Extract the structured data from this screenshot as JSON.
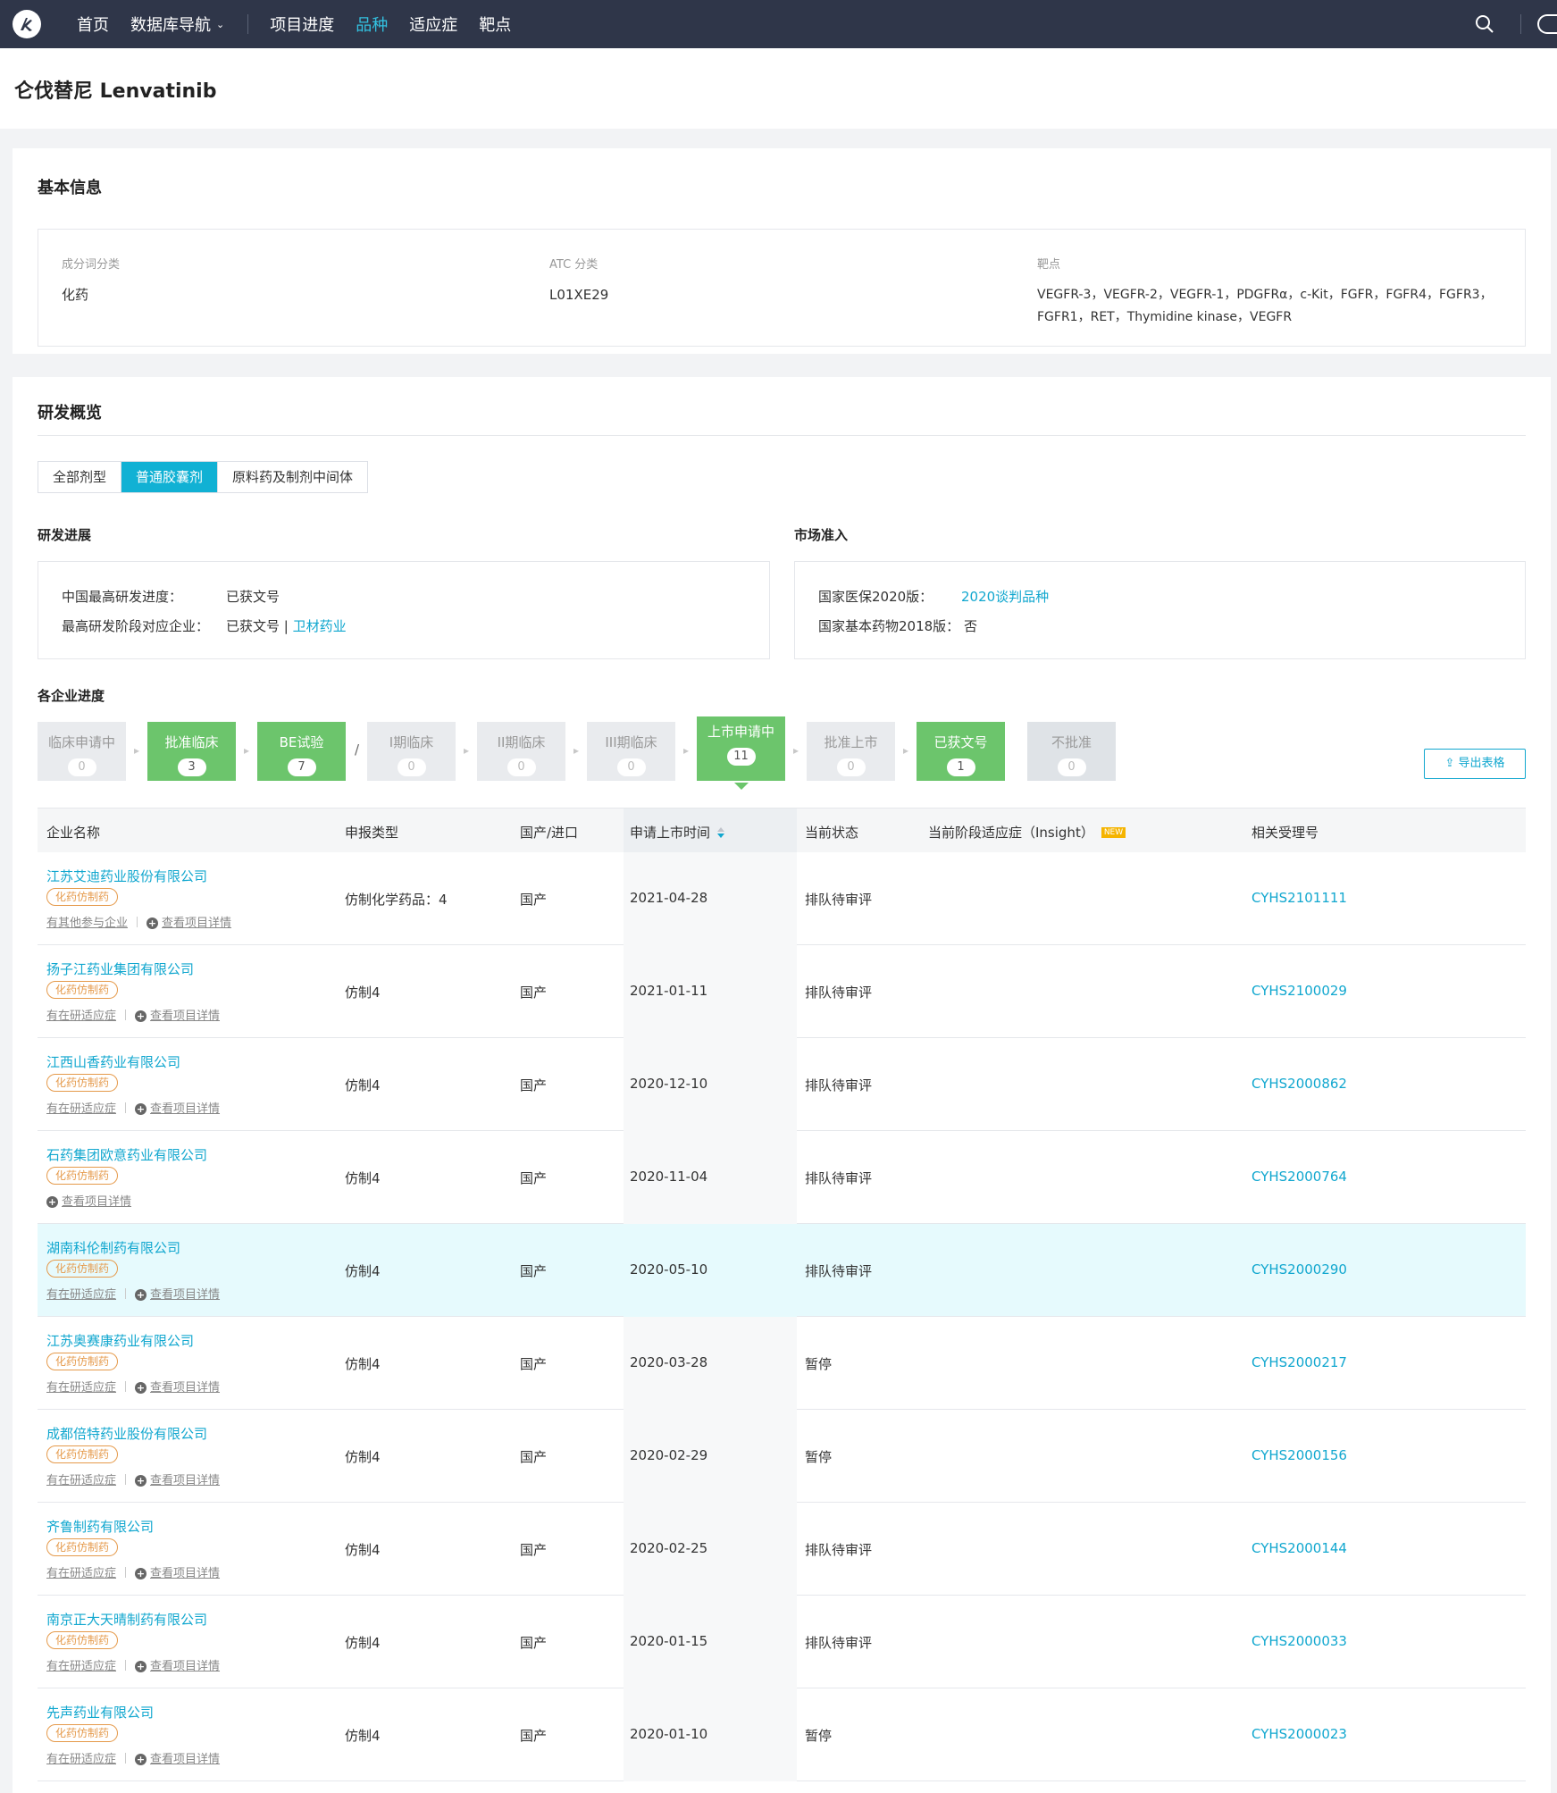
{
  "nav": {
    "items": [
      "首页",
      "数据库导航",
      "项目进度",
      "品种",
      "适应症",
      "靶点"
    ]
  },
  "page": {
    "title": "仑伐替尼 Lenvatinib"
  },
  "basic": {
    "title": "基本信息",
    "fields": [
      {
        "label": "成分词分类",
        "value": "化药"
      },
      {
        "label": "ATC 分类",
        "value": "L01XE29"
      },
      {
        "label": "靶点",
        "value": "VEGFR-3，VEGFR-2，VEGFR-1，PDGFRα，c-Kit，FGFR，FGFR4，FGFR3，FGFR1，RET，Thymidine kinase，VEGFR"
      }
    ]
  },
  "overview": {
    "title": "研发概览",
    "tabs": [
      "全部剂型",
      "普通胶囊剂",
      "原料药及制剂中间体"
    ],
    "active_tab": 1,
    "progress": {
      "title": "研发进展",
      "highest_label": "中国最高研发进度：",
      "highest_value": "已获文号",
      "company_label": "最高研发阶段对应企业：",
      "company_value": "已获文号 |",
      "company_link": "卫材药业"
    },
    "market": {
      "title": "市场准入",
      "insurance_label": "国家医保2020版：",
      "insurance_value": "2020谈判品种",
      "essential_label": "国家基本药物2018版：",
      "essential_value": "否"
    },
    "company_progress_title": "各企业进度",
    "stages": [
      {
        "name": "临床申请中",
        "count": "0",
        "state": "gray"
      },
      {
        "name": "批准临床",
        "count": "3",
        "state": "green"
      },
      {
        "name": "BE试验",
        "count": "7",
        "state": "green"
      },
      {
        "name": "I期临床",
        "count": "0",
        "state": "gray"
      },
      {
        "name": "II期临床",
        "count": "0",
        "state": "gray"
      },
      {
        "name": "III期临床",
        "count": "0",
        "state": "gray"
      },
      {
        "name": "上市申请中",
        "count": "11",
        "state": "selected"
      },
      {
        "name": "批准上市",
        "count": "0",
        "state": "gray"
      },
      {
        "name": "已获文号",
        "count": "1",
        "state": "green"
      },
      {
        "name": "不批准",
        "count": "0",
        "state": "gray2"
      }
    ],
    "export_label": "导出表格"
  },
  "table": {
    "headers": [
      "企业名称",
      "申报类型",
      "国产/进口",
      "申请上市时间",
      "当前状态",
      "当前阶段适应症（Insight）",
      "相关受理号"
    ],
    "new_badge": "NEW",
    "rows": [
      {
        "company": "江苏艾迪药业股份有限公司",
        "tag": "化药仿制药",
        "link1": "有其他参与企业",
        "link2": "查看项目详情",
        "type": "仿制化学药品：4",
        "origin": "国产",
        "date": "2021-04-28",
        "status": "排队待审评",
        "indication": "",
        "accept_no": "CYHS2101111"
      },
      {
        "company": "扬子江药业集团有限公司",
        "tag": "化药仿制药",
        "link1": "有在研适应症",
        "link2": "查看项目详情",
        "type": "仿制4",
        "origin": "国产",
        "date": "2021-01-11",
        "status": "排队待审评",
        "indication": "",
        "accept_no": "CYHS2100029"
      },
      {
        "company": "江西山香药业有限公司",
        "tag": "化药仿制药",
        "link1": "有在研适应症",
        "link2": "查看项目详情",
        "type": "仿制4",
        "origin": "国产",
        "date": "2020-12-10",
        "status": "排队待审评",
        "indication": "",
        "accept_no": "CYHS2000862"
      },
      {
        "company": "石药集团欧意药业有限公司",
        "tag": "化药仿制药",
        "link1": "",
        "link2": "查看项目详情",
        "type": "仿制4",
        "origin": "国产",
        "date": "2020-11-04",
        "status": "排队待审评",
        "indication": "",
        "accept_no": "CYHS2000764"
      },
      {
        "company": "湖南科伦制药有限公司",
        "tag": "化药仿制药",
        "link1": "有在研适应症",
        "link2": "查看项目详情",
        "type": "仿制4",
        "origin": "国产",
        "date": "2020-05-10",
        "status": "排队待审评",
        "indication": "",
        "accept_no": "CYHS2000290"
      },
      {
        "company": "江苏奥赛康药业有限公司",
        "tag": "化药仿制药",
        "link1": "有在研适应症",
        "link2": "查看项目详情",
        "type": "仿制4",
        "origin": "国产",
        "date": "2020-03-28",
        "status": "暂停",
        "indication": "",
        "accept_no": "CYHS2000217"
      },
      {
        "company": "成都倍特药业股份有限公司",
        "tag": "化药仿制药",
        "link1": "有在研适应症",
        "link2": "查看项目详情",
        "type": "仿制4",
        "origin": "国产",
        "date": "2020-02-29",
        "status": "暂停",
        "indication": "",
        "accept_no": "CYHS2000156"
      },
      {
        "company": "齐鲁制药有限公司",
        "tag": "化药仿制药",
        "link1": "有在研适应症",
        "link2": "查看项目详情",
        "type": "仿制4",
        "origin": "国产",
        "date": "2020-02-25",
        "status": "排队待审评",
        "indication": "",
        "accept_no": "CYHS2000144"
      },
      {
        "company": "南京正大天晴制药有限公司",
        "tag": "化药仿制药",
        "link1": "有在研适应症",
        "link2": "查看项目详情",
        "type": "仿制4",
        "origin": "国产",
        "date": "2020-01-15",
        "status": "排队待审评",
        "indication": "",
        "accept_no": "CYHS2000033"
      },
      {
        "company": "先声药业有限公司",
        "tag": "化药仿制药",
        "link1": "有在研适应症",
        "link2": "查看项目详情",
        "type": "仿制4",
        "origin": "国产",
        "date": "2020-01-10",
        "status": "暂停",
        "indication": "",
        "accept_no": "CYHS2000023"
      }
    ]
  }
}
